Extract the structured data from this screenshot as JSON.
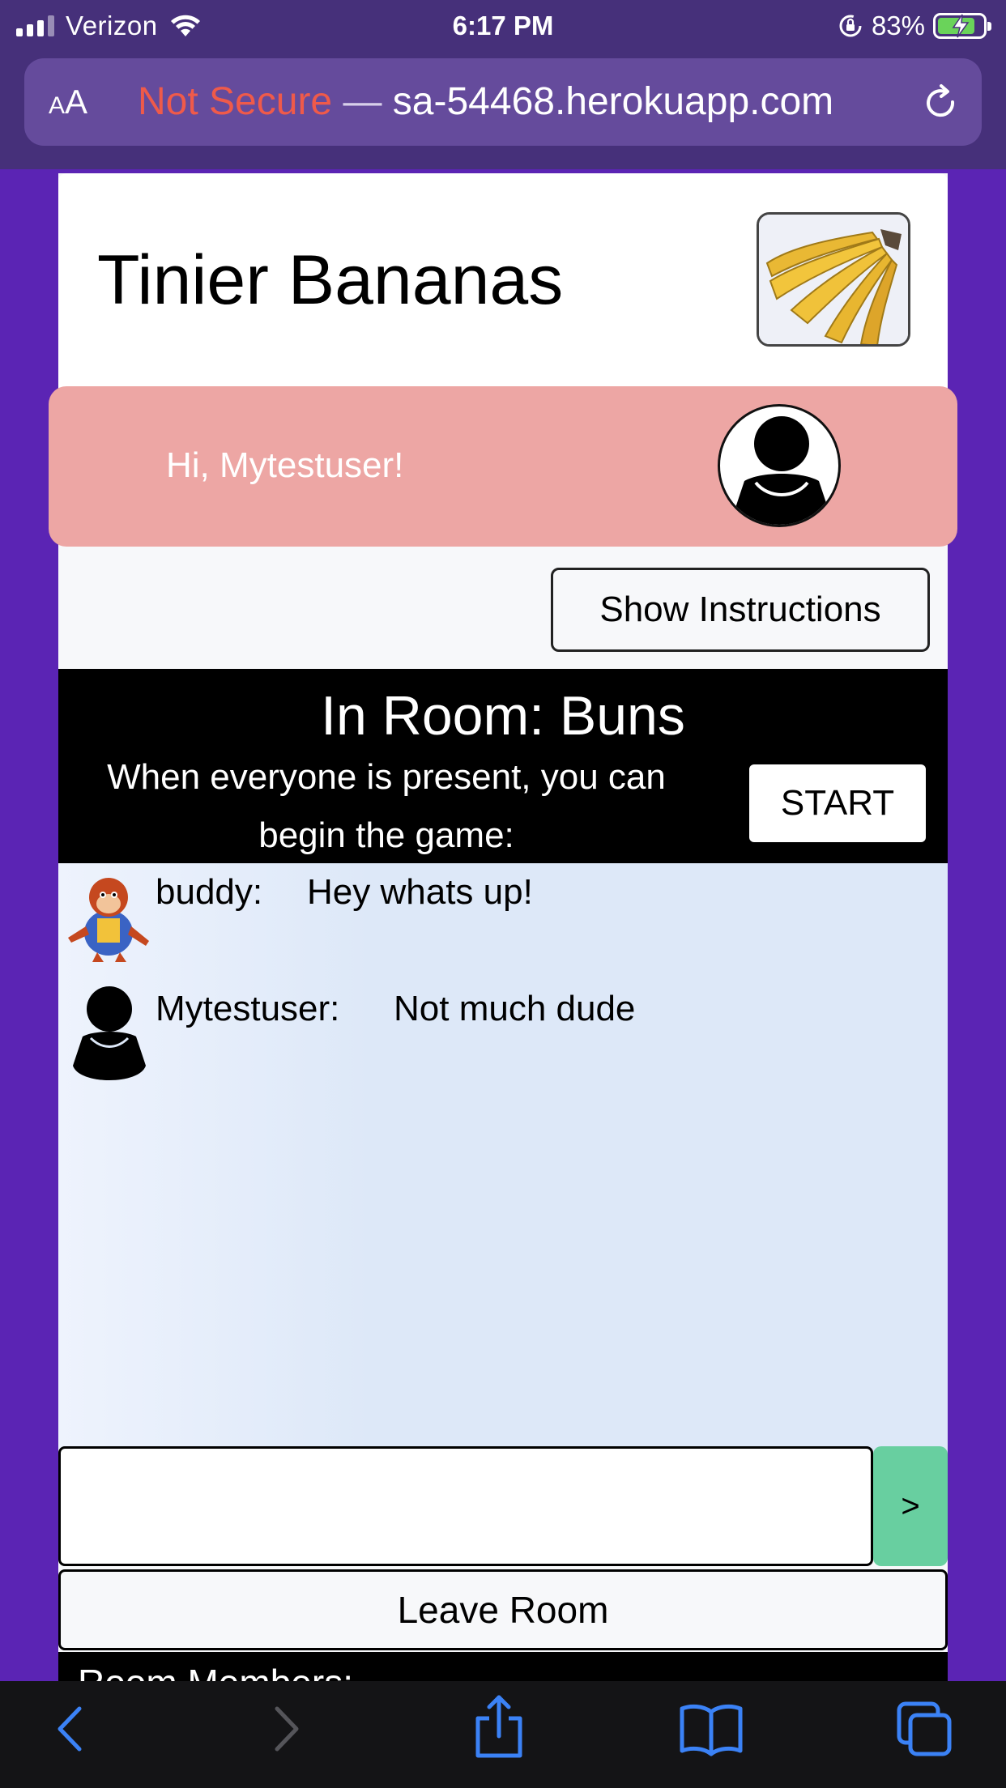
{
  "status_bar": {
    "carrier": "Verizon",
    "time": "6:17 PM",
    "battery_percent": "83%",
    "battery_level": 0.83,
    "signal_bars_active": 3,
    "icons": [
      "cellular-signal-icon",
      "wifi-icon",
      "orientation-lock-icon",
      "battery-charging-icon"
    ]
  },
  "browser": {
    "text_size_label_small": "A",
    "text_size_label_large": "A",
    "security_label": "Not Secure",
    "separator": " — ",
    "url": "sa-54468.herokuapp.com",
    "reload_icon": "reload-icon"
  },
  "header": {
    "site_title": "Tinier Bananas",
    "logo_icon": "bananas-logo"
  },
  "greeting": {
    "text": "Hi, Mytestuser!",
    "avatar_icon": "user-silhouette-icon"
  },
  "instructions_button": "Show Instructions",
  "room": {
    "title": "In Room: Buns",
    "hint": "When everyone is present, you can begin the game:",
    "start_button": "START"
  },
  "chat": {
    "messages": [
      {
        "user": "buddy:",
        "text": "Hey whats up!",
        "avatar": "monkey-avatar"
      },
      {
        "user": "Mytestuser:",
        "text": "Not much dude",
        "avatar": "user-silhouette-icon"
      }
    ]
  },
  "composer": {
    "input_value": "",
    "send_label": ">"
  },
  "leave_button": "Leave Room",
  "members_heading": "Room Members:",
  "toolbar": {
    "icons": [
      "back-icon",
      "forward-icon",
      "share-icon",
      "bookmarks-icon",
      "tabs-icon"
    ]
  },
  "colors": {
    "page_background": "#5b24b4",
    "browser_chrome": "#46307a",
    "not_secure": "#ef5a4a",
    "greeting_panel": "#eda6a4",
    "send_button": "#68cfa0",
    "battery_fill": "#6ad35a"
  }
}
